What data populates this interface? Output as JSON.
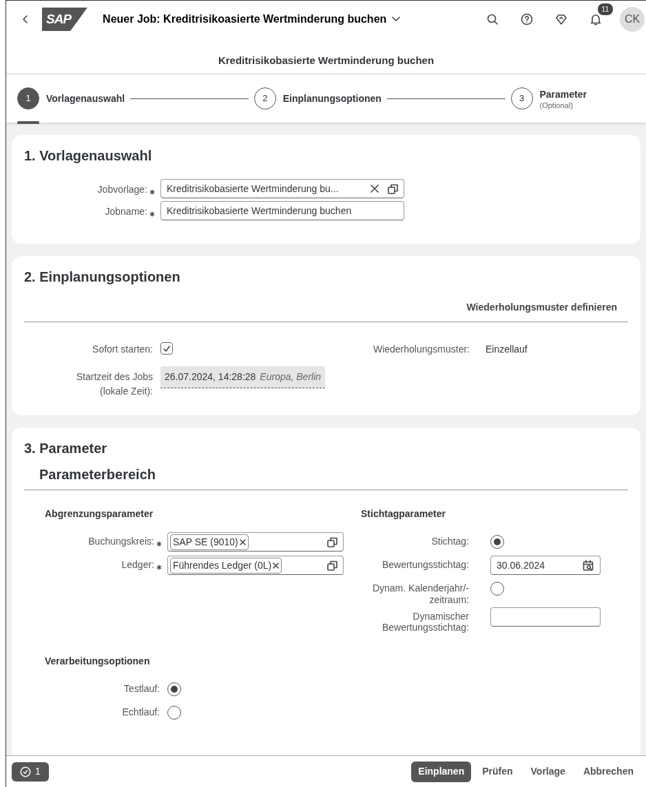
{
  "shell": {
    "logo": "SAP",
    "title": "Neuer Job: Kreditrisikoasierte Wertminderung buchen",
    "notifications": "11",
    "avatar": "CK"
  },
  "page_title": "Kreditrisikobasierte Wertminderung buchen",
  "steps": [
    {
      "number": "1",
      "label": "Vorlagenauswahl",
      "selected": true
    },
    {
      "number": "2",
      "label": "Einplanungsoptionen",
      "selected": false
    },
    {
      "number": "3",
      "label": "Parameter",
      "note": "(Optional)",
      "selected": false
    }
  ],
  "template_section": {
    "title": "1. Vorlagenauswahl",
    "fields": [
      {
        "label": "Jobvorlage:",
        "required": true,
        "kind": "combo",
        "value": "Kreditrisikobasierte Wertminderung bu..."
      },
      {
        "label": "Jobname:",
        "required": true,
        "kind": "input",
        "value": "Kreditrisikobasierte Wertminderung buchen"
      }
    ]
  },
  "scheduling_section": {
    "title": "2. Einplanungsoptionen",
    "link": "Wiederholungsmuster definieren",
    "fields_left": [
      {
        "label": "Sofort starten:",
        "required": false,
        "kind": "checkbox",
        "checked": true
      },
      {
        "label": "Startzeit des Jobs (lokale Zeit):",
        "required": false,
        "kind": "datetime",
        "value": "26.07.2024, 14:28:28",
        "timezone": "Europa, Berlin",
        "disabled": true
      }
    ],
    "fields_right": [
      {
        "label": "Wiederholungsmuster:",
        "required": false,
        "kind": "text",
        "value": "Einzellauf"
      }
    ]
  },
  "parameter_section": {
    "title": "3. Parameter",
    "area_title": "Parameterbereich",
    "group_rows": [
      [
        {
          "title": "Abgrenzungsparameter",
          "fields": [
            {
              "label": "Buchungskreis:",
              "required": true,
              "kind": "tokens",
              "tokens": [
                "SAP SE (9010)"
              ]
            },
            {
              "label": "Ledger:",
              "required": true,
              "kind": "tokens",
              "tokens": [
                "Führendes Ledger (0L)"
              ]
            }
          ]
        },
        {
          "title": "Stichtagparameter",
          "fields": [
            {
              "label": "Stichtag:",
              "required": false,
              "kind": "radio",
              "selected": true
            },
            {
              "label": "Bewertungsstichtag:",
              "required": false,
              "kind": "date",
              "value": "30.06.2024"
            },
            {
              "label": "Dynam. Kalenderjahr/-zeitraum:",
              "required": false,
              "kind": "radio",
              "selected": false
            },
            {
              "label": "Dynamischer Bewertungsstichtag:",
              "required": false,
              "kind": "input"
            }
          ]
        }
      ],
      [
        {
          "title": "Verarbeitungsoptionen",
          "fields": [
            {
              "label": "Testlauf:",
              "required": false,
              "kind": "radio",
              "selected": true
            },
            {
              "label": "Echtlauf:",
              "required": false,
              "kind": "radio",
              "selected": false
            }
          ]
        }
      ]
    ]
  },
  "footer": {
    "messages": "1",
    "actions": [
      {
        "label": "Einplanen",
        "kind": "emphasized"
      },
      {
        "label": "Prüfen",
        "kind": "transparent"
      },
      {
        "label": "Vorlage",
        "kind": "transparent"
      },
      {
        "label": "Abbrechen",
        "kind": "transparent"
      }
    ]
  }
}
